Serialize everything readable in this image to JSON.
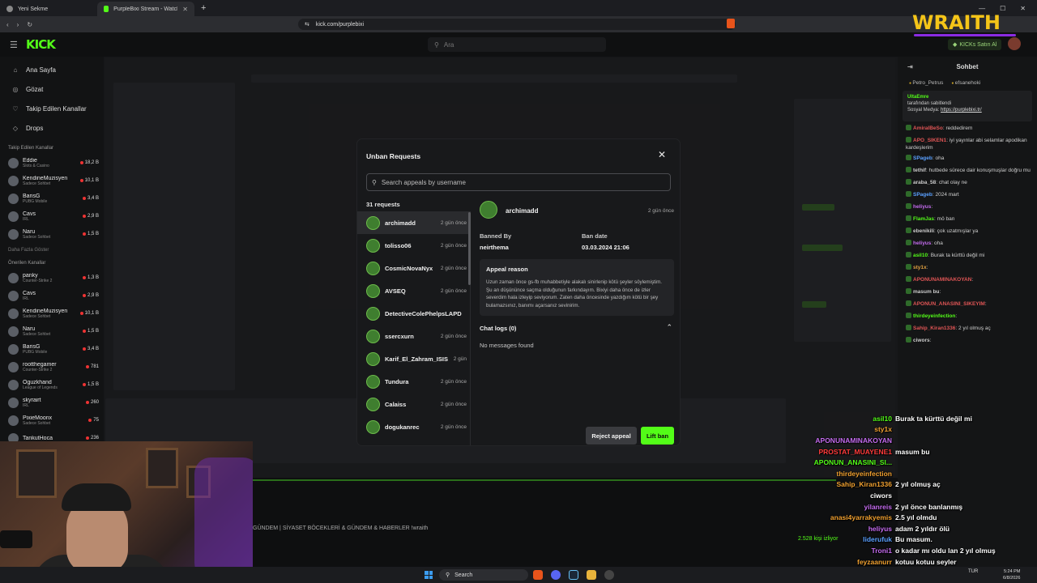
{
  "browser": {
    "tabs": [
      {
        "label": "Yeni Sekme",
        "active": false
      },
      {
        "label": "PurpleBixi Stream - Watch Live o",
        "active": true
      }
    ],
    "url": "kick.com/purplebixi"
  },
  "header": {
    "logo": "KICK",
    "search_placeholder": "Ara",
    "kicks_label": "KICKs Satın Al"
  },
  "sidebar": {
    "nav": [
      {
        "label": "Ana Sayfa",
        "icon": "home-icon"
      },
      {
        "label": "Gözat",
        "icon": "compass-icon"
      },
      {
        "label": "Takip Edilen Kanallar",
        "icon": "heart-icon"
      },
      {
        "label": "Drops",
        "icon": "drops-icon"
      }
    ],
    "followed_title": "Takip Edilen Kanallar",
    "followed": [
      {
        "name": "Eddie",
        "category": "Slots & Casino",
        "viewers": "18,2 B"
      },
      {
        "name": "KendineMuzisyen",
        "category": "Sadece Sohbet",
        "viewers": "10,1 B"
      },
      {
        "name": "BarisG",
        "category": "PUBG Mobile",
        "viewers": "3,4 B"
      },
      {
        "name": "Cavs",
        "category": "IRL",
        "viewers": "2,9 B"
      },
      {
        "name": "Naru",
        "category": "Sadece Sohbet",
        "viewers": "1,5 B"
      }
    ],
    "show_more": "Daha Fazla Göster",
    "recommended_title": "Önerilen Kanallar",
    "recommended": [
      {
        "name": "panky",
        "category": "Counter-Strike 2",
        "viewers": "1,3 B"
      },
      {
        "name": "Cavs",
        "category": "IRL",
        "viewers": "2,9 B"
      },
      {
        "name": "KendineMuzisyen",
        "category": "Sadece Sohbet",
        "viewers": "10,1 B"
      },
      {
        "name": "Naru",
        "category": "Sadece Sohbet",
        "viewers": "1,5 B"
      },
      {
        "name": "BarisG",
        "category": "PUBG Mobile",
        "viewers": "3,4 B"
      },
      {
        "name": "rootthegamer",
        "category": "Counter-Strike 2",
        "viewers": "781"
      },
      {
        "name": "Oguzkhand",
        "category": "League of Legends",
        "viewers": "1,5 B"
      },
      {
        "name": "skyrairt",
        "category": "IRL",
        "viewers": "260"
      },
      {
        "name": "PixieMoonx",
        "category": "Sadece Sohbet",
        "viewers": "75"
      },
      {
        "name": "TankutHoca",
        "category": "",
        "viewers": "236"
      }
    ]
  },
  "modal": {
    "title": "Unban Requests",
    "search_placeholder": "Search appeals by username",
    "count": "31 requests",
    "requests": [
      {
        "name": "archimadd",
        "time": "2 gün önce"
      },
      {
        "name": "tolisso06",
        "time": "2 gün önce"
      },
      {
        "name": "CosmicNovaNyx",
        "time": "2 gün önce"
      },
      {
        "name": "AVSEQ",
        "time": "2 gün önce"
      },
      {
        "name": "DetectiveColePhelpsLAPD",
        "time": ""
      },
      {
        "name": "ssercxurn",
        "time": "2 gün önce"
      },
      {
        "name": "Karif_El_Zahram_ISIS",
        "time": "2 gün"
      },
      {
        "name": "Tundura",
        "time": "2 gün önce"
      },
      {
        "name": "Calaiss",
        "time": "2 gün önce"
      },
      {
        "name": "dogukanrec",
        "time": "2 gün önce"
      }
    ],
    "detail": {
      "name": "archimadd",
      "time": "2 gün önce",
      "banned_by_label": "Banned By",
      "banned_by": "neirthema",
      "ban_date_label": "Ban date",
      "ban_date": "03.03.2024 21:06",
      "appeal_title": "Appeal reason",
      "appeal_text": "Uzun zaman önce gs-fb muhabbetiyle alakalı sinirlenip kötü şeyler söylemiştim. Şu an düşününce saçma olduğunun farkındayım. Bixiyi daha önce de izler severdim hala izleyip seviyorum. Zaten daha öncesinde yazdığım kötü bir şey bulamazsınız, banımı açarsanız sevinirim.",
      "chat_logs": "Chat logs (0)",
      "no_messages": "No messages found"
    },
    "reject_label": "Reject appeal",
    "lift_label": "Lift ban"
  },
  "chat": {
    "title": "Sohbet",
    "pins": [
      "Petro_Petrus",
      "efsanehoki"
    ],
    "pinned_user": "UltaEmre",
    "pinned_line1": "tarafından sabitlendi",
    "pinned_line2": "Sosyal Medya:",
    "pinned_link": "https://purplebixi.tr/",
    "messages": [
      {
        "user": "AmiralBeSo",
        "color": "#e05555",
        "text": "reddedirem"
      },
      {
        "user": "APO_SIKEN1",
        "color": "#e05555",
        "text": "iyi yayınlar abi selamlar apodikan kardeşlerim"
      },
      {
        "user": "SPageb",
        "color": "#5aa0ff",
        "text": "oha"
      },
      {
        "user": "tethif",
        "color": "#cccccc",
        "text": "hutbede sürece dair konuşmuşlar doğru mu"
      },
      {
        "user": "araba_58",
        "color": "#cccccc",
        "text": "chat olay ne"
      },
      {
        "user": "SPageb",
        "color": "#5aa0ff",
        "text": "2024 mart"
      },
      {
        "user": "heliyus",
        "color": "#c56cf0",
        "text": ""
      },
      {
        "user": "FlamJas",
        "color": "#53fc18",
        "text": "mö ban"
      },
      {
        "user": "ebenikili",
        "color": "#cccccc",
        "text": "çok uzatmışlar ya"
      },
      {
        "user": "heliyus",
        "color": "#c56cf0",
        "text": "oha"
      },
      {
        "user": "asil10",
        "color": "#53fc18",
        "text": "Burak ta kürttü değil mi"
      },
      {
        "user": "sty1x",
        "color": "#e0a040",
        "text": ""
      },
      {
        "user": "APONUNAMINAKOYAN",
        "color": "#e05555",
        "text": ""
      },
      {
        "user": "masum bu",
        "color": "#cccccc",
        "text": ""
      },
      {
        "user": "APONUN_ANASINI_SIKEYIM",
        "color": "#e05555",
        "text": ""
      },
      {
        "user": "thirdeyeinfection",
        "color": "#53fc18",
        "text": ""
      },
      {
        "user": "Sahip_Kiran1336",
        "color": "#e05555",
        "text": "2 yıl olmuş aç"
      },
      {
        "user": "ciwors",
        "color": "#cccccc",
        "text": ""
      }
    ]
  },
  "overlay_chat": [
    {
      "user": "asil10",
      "color": "#53fc18",
      "text": "Burak ta kürttü değil mi"
    },
    {
      "user": "sty1x",
      "color": "#f0a030",
      "text": ""
    },
    {
      "user": "APONUNAMINAKOYAN",
      "color": "#c56cf0",
      "text": ""
    },
    {
      "user": "PROSTAT_MUAYENE1",
      "color": "#ff3b3b",
      "text": "masum bu"
    },
    {
      "user": "APONUN_ANASINI_SI...",
      "color": "#53fc18",
      "text": ""
    },
    {
      "user": "thirdeyeinfection",
      "color": "#f0a030",
      "text": ""
    },
    {
      "user": "Sahip_Kiran1336",
      "color": "#f0a030",
      "text": "2 yıl olmuş aç"
    },
    {
      "user": "ciwors",
      "color": "#ffffff",
      "text": ""
    },
    {
      "user": "yilanreis",
      "color": "#c56cf0",
      "text": "2 yıl önce banlanmış"
    },
    {
      "user": "anasi4yarrakyemis",
      "color": "#f0a030",
      "text": "2.5 yıl olmdu"
    },
    {
      "user": "heliyus",
      "color": "#c56cf0",
      "text": "adam 2 yıldır ölü"
    },
    {
      "user": "liderufuk",
      "color": "#5aa0ff",
      "text": "Bu masum."
    },
    {
      "user": "Troni1",
      "color": "#c56cf0",
      "text": "o kadar mı oldu lan 2 yıl olmuş"
    },
    {
      "user": "feyzaanurr",
      "color": "#f0a030",
      "text": "kotuu kotuu seyler"
    },
    {
      "user": "heliyus",
      "color": "#c56cf0",
      "text": ""
    }
  ],
  "stream": {
    "title": "GÜNDEM | SİYASET BÖCEKLERİ & GÜNDEM & HABERLER !wraith",
    "viewers": "2.528 kişi izliyor",
    "logo": "WRAITH"
  },
  "taskbar": {
    "search": "Search",
    "lang": "TUR",
    "time": "5:24 PM",
    "date": "6/8/2026"
  }
}
